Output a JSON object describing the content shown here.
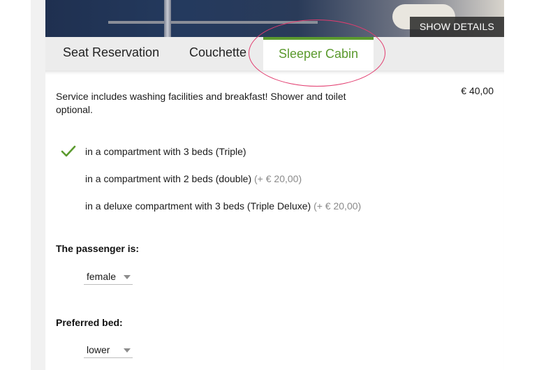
{
  "hero": {
    "show_details_label": "SHOW DETAILS"
  },
  "tabs": [
    {
      "label": "Seat Reservation"
    },
    {
      "label": "Couchette"
    },
    {
      "label": "Sleeper Cabin",
      "active": true
    }
  ],
  "panel": {
    "description": "Service includes washing facilities and breakfast! Shower and toilet optional.",
    "price": "€  40,00",
    "options": [
      {
        "label": "in a compartment with 3 beds (Triple)",
        "extra": "",
        "selected": true
      },
      {
        "label": "in a compartment with 2 beds (double)",
        "extra": "(+ € 20,00)",
        "selected": false
      },
      {
        "label": "in a deluxe compartment with 3 beds (Triple Deluxe)",
        "extra": "(+ € 20,00)",
        "selected": false
      }
    ],
    "passenger": {
      "label": "The passenger is:",
      "value": "female"
    },
    "preferred_bed": {
      "label": "Preferred bed:",
      "value": "lower"
    }
  },
  "colors": {
    "accent": "#5b9a2e",
    "highlight": "#e23c6f",
    "muted": "#8a8a8a"
  },
  "icons": {
    "selected_option": "checkmark-icon",
    "dropdown": "caret-down-icon"
  }
}
